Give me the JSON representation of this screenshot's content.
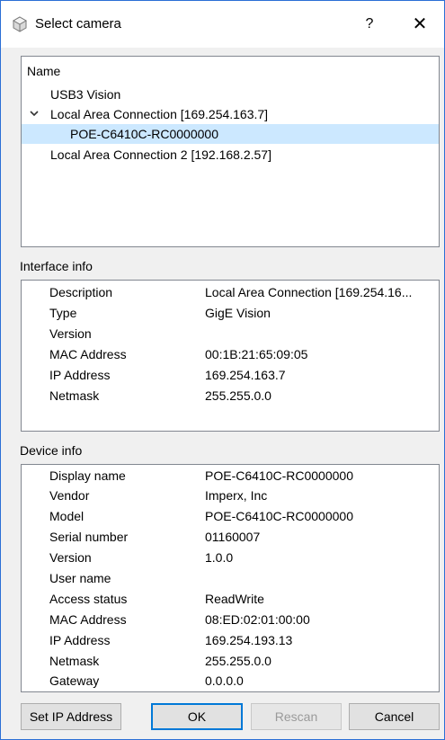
{
  "window": {
    "title": "Select camera",
    "help_label": "?",
    "close_label": "✕"
  },
  "tree": {
    "header": "Name",
    "items": [
      {
        "label": "USB3 Vision"
      },
      {
        "label": "Local Area Connection [169.254.163.7]"
      },
      {
        "label": "POE-C6410C-RC0000000"
      },
      {
        "label": "Local Area Connection 2 [192.168.2.57]"
      }
    ]
  },
  "interface_info": {
    "title": "Interface info",
    "rows": [
      {
        "key": "Description",
        "value": "Local Area Connection [169.254.16..."
      },
      {
        "key": "Type",
        "value": "GigE Vision"
      },
      {
        "key": "Version",
        "value": ""
      },
      {
        "key": "MAC Address",
        "value": "00:1B:21:65:09:05"
      },
      {
        "key": "IP Address",
        "value": "169.254.163.7"
      },
      {
        "key": "Netmask",
        "value": "255.255.0.0"
      }
    ]
  },
  "device_info": {
    "title": "Device info",
    "rows": [
      {
        "key": "Display name",
        "value": "POE-C6410C-RC0000000"
      },
      {
        "key": "Vendor",
        "value": "Imperx, Inc"
      },
      {
        "key": "Model",
        "value": "POE-C6410C-RC0000000"
      },
      {
        "key": "Serial number",
        "value": "01160007"
      },
      {
        "key": "Version",
        "value": "1.0.0"
      },
      {
        "key": "User name",
        "value": ""
      },
      {
        "key": "Access status",
        "value": "ReadWrite"
      },
      {
        "key": "MAC Address",
        "value": "08:ED:02:01:00:00"
      },
      {
        "key": "IP Address",
        "value": "169.254.193.13"
      },
      {
        "key": "Netmask",
        "value": "255.255.0.0"
      },
      {
        "key": "Gateway",
        "value": "0.0.0.0"
      }
    ]
  },
  "buttons": {
    "set_ip": "Set IP Address",
    "ok": "OK",
    "rescan": "Rescan",
    "cancel": "Cancel"
  },
  "colors": {
    "selection": "#cce8ff",
    "window_border": "#2b6fd6",
    "default_button_border": "#0078d7"
  }
}
